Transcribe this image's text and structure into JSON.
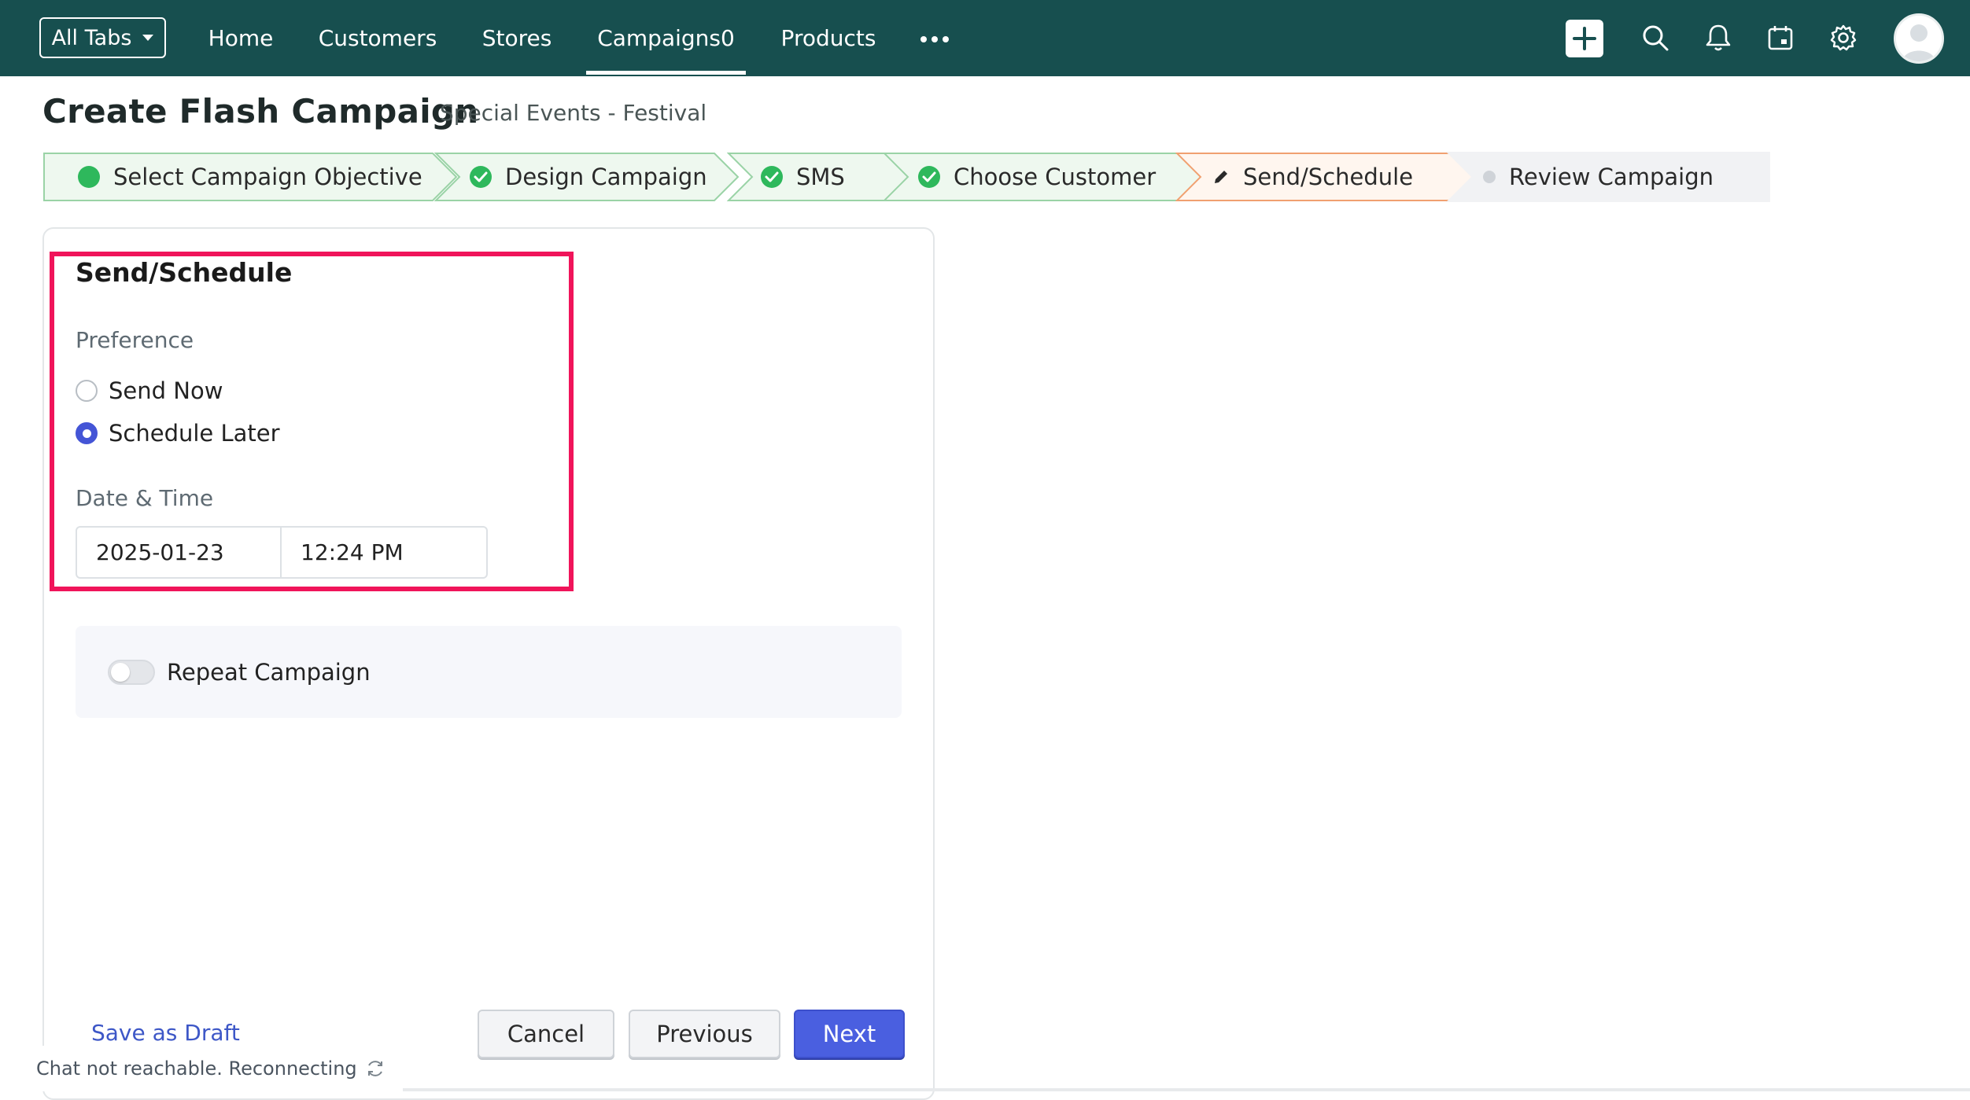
{
  "topnav": {
    "all_tabs_label": "All Tabs",
    "tabs": [
      "Home",
      "Customers",
      "Stores",
      "Campaigns0",
      "Products"
    ],
    "active_tab": "Campaigns0",
    "icons": [
      "plus-icon",
      "search-icon",
      "bell-icon",
      "calendar-icon",
      "gear-icon",
      "avatar"
    ]
  },
  "header": {
    "title": "Create Flash Campaign",
    "subtitle": "Special Events - Festival"
  },
  "stepper": {
    "steps": [
      {
        "label": "Select Campaign Objective",
        "status": "done"
      },
      {
        "label": "Design Campaign",
        "status": "done"
      },
      {
        "label": "SMS",
        "status": "done"
      },
      {
        "label": "Choose Customer",
        "status": "done"
      },
      {
        "label": "Send/Schedule",
        "status": "current"
      },
      {
        "label": "Review Campaign",
        "status": "pending"
      }
    ]
  },
  "form": {
    "section_title": "Send/Schedule",
    "preference_label": "Preference",
    "options": [
      {
        "label": "Send Now",
        "checked": false
      },
      {
        "label": "Schedule Later",
        "checked": true
      }
    ],
    "datetime_label": "Date & Time",
    "date_value": "2025-01-23",
    "time_value": "12:24 PM",
    "repeat_label": "Repeat Campaign",
    "repeat_enabled": false
  },
  "footer": {
    "save_draft": "Save as Draft",
    "cancel": "Cancel",
    "previous": "Previous",
    "next": "Next"
  },
  "chat_status": "Chat not reachable. Reconnecting",
  "colors": {
    "topbar": "#174f4f",
    "primary": "#4a5fe0",
    "done_green": "#2eb85c",
    "current_orange": "#f0a070",
    "highlight": "#f0145a"
  }
}
